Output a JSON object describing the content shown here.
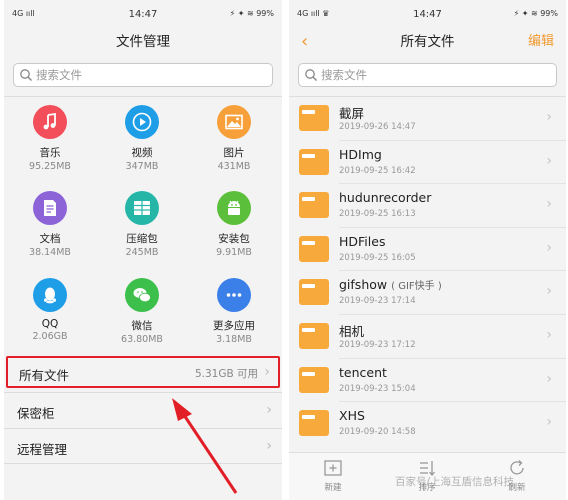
{
  "left": {
    "status": {
      "network": "4G ııll",
      "time": "14:47",
      "right": "⚡ ✦ ≋ 99%"
    },
    "title": "文件管理",
    "search_placeholder": "搜索文件",
    "categories": [
      {
        "name": "音乐",
        "size": "95.25MB",
        "color": "#f24f5b",
        "icon": "music-icon"
      },
      {
        "name": "视频",
        "size": "347MB",
        "color": "#1f9ee8",
        "icon": "play-icon"
      },
      {
        "name": "图片",
        "size": "431MB",
        "color": "#f7a03a",
        "icon": "image-icon"
      },
      {
        "name": "文档",
        "size": "38.14MB",
        "color": "#8d63d8",
        "icon": "document-icon"
      },
      {
        "name": "压缩包",
        "size": "245MB",
        "color": "#25b6a8",
        "icon": "archive-icon"
      },
      {
        "name": "安装包",
        "size": "9.91MB",
        "color": "#5cbf3b",
        "icon": "android-icon"
      },
      {
        "name": "QQ",
        "size": "2.06GB",
        "color": "#1f9ee8",
        "icon": "qq-icon"
      },
      {
        "name": "微信",
        "size": "63.80MB",
        "color": "#3cbf4b",
        "icon": "wechat-icon"
      },
      {
        "name": "更多应用",
        "size": "3.18MB",
        "color": "#3b7fe8",
        "icon": "more-icon"
      }
    ],
    "rows": [
      {
        "label": "所有文件",
        "value": "5.31GB 可用"
      },
      {
        "label": "保密柜",
        "value": ""
      },
      {
        "label": "远程管理",
        "value": ""
      }
    ]
  },
  "right": {
    "status": {
      "network": "4G ııll ♛",
      "time": "14:47",
      "right": "⚡ ✦ ≋ 99%"
    },
    "back": "‹",
    "title": "所有文件",
    "edit": "编辑",
    "search_placeholder": "搜索文件",
    "files": [
      {
        "name": "截屏",
        "tag": "",
        "date": "2019-09-26 14:47"
      },
      {
        "name": "HDImg",
        "tag": "",
        "date": "2019-09-25 16:42"
      },
      {
        "name": "hudunrecorder",
        "tag": "",
        "date": "2019-09-25 16:13"
      },
      {
        "name": "HDFiles",
        "tag": "",
        "date": "2019-09-25 16:05"
      },
      {
        "name": "gifshow",
        "tag": "( GIF快手 )",
        "date": "2019-09-23 17:14"
      },
      {
        "name": "相机",
        "tag": "",
        "date": "2019-09-23 17:12"
      },
      {
        "name": "tencent",
        "tag": "",
        "date": "2019-09-23 15:04"
      },
      {
        "name": "XHS",
        "tag": "",
        "date": "2019-09-20 14:58"
      }
    ],
    "toolbar": {
      "new": "新建",
      "sort": "排序",
      "refresh": "刷新"
    }
  },
  "watermark": "百家号/上海互盾信息科技",
  "accent": "#f19a2f",
  "highlight_color": "#e21f26",
  "folder_color": "#f7a93b"
}
